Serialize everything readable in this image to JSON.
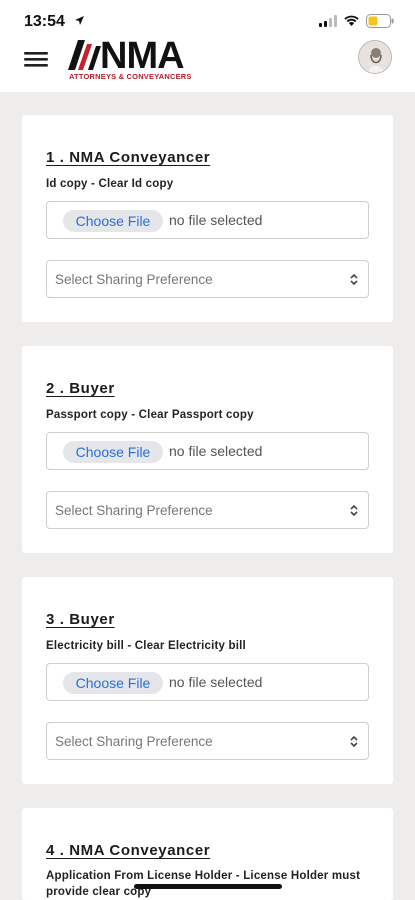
{
  "status_bar": {
    "time": "13:54"
  },
  "header": {
    "logo_text": "NMA",
    "logo_subtitle": "ATTORNEYS & CONVEYANCERS",
    "menu_icon": "hamburger-icon",
    "avatar_icon": "user-avatar"
  },
  "colors": {
    "brand_red": "#c8202c",
    "link_blue": "#2a6fd6",
    "page_bg": "#efedeb",
    "battery_yellow": "#f5c518"
  },
  "cards": [
    {
      "title": "1 . NMA Conveyancer",
      "desc": "Id copy - Clear Id copy",
      "choose_label": "Choose File",
      "file_status": "no file selected",
      "select_placeholder": "Select Sharing Preference"
    },
    {
      "title": "2 . Buyer",
      "desc": "Passport copy - Clear Passport copy",
      "choose_label": "Choose File",
      "file_status": "no file selected",
      "select_placeholder": "Select Sharing Preference"
    },
    {
      "title": "3 . Buyer",
      "desc": "Electricity bill - Clear Electricity bill",
      "choose_label": "Choose File",
      "file_status": "no file selected",
      "select_placeholder": "Select Sharing Preference"
    },
    {
      "title": "4 . NMA Conveyancer",
      "desc": "Application From License Holder - License Holder must provide clear copy"
    }
  ]
}
